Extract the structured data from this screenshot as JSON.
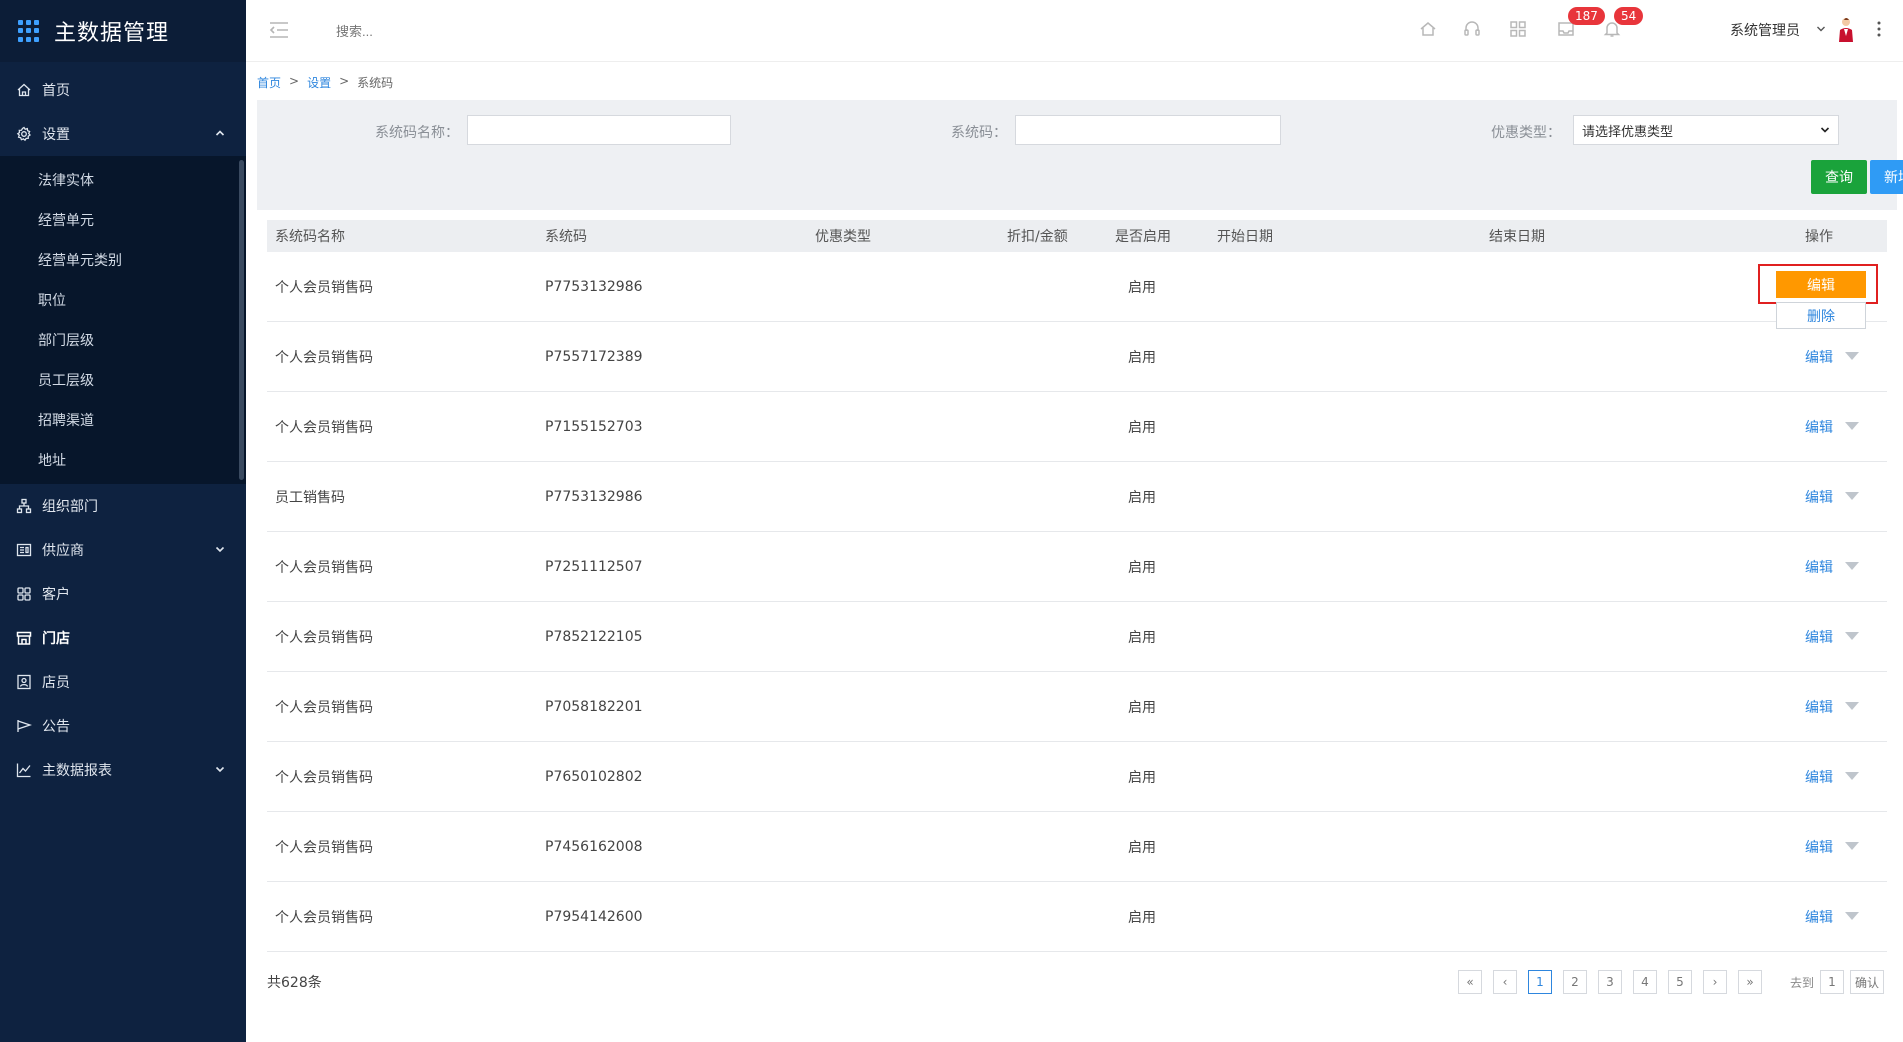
{
  "app": {
    "title": "主数据管理"
  },
  "sidebar": {
    "items": [
      {
        "label": "首页",
        "icon": "home-icon"
      },
      {
        "label": "设置",
        "icon": "gear-icon"
      },
      {
        "label": "组织部门",
        "icon": "org-tree-icon"
      },
      {
        "label": "供应商",
        "icon": "supplier-icon"
      },
      {
        "label": "客户",
        "icon": "customer-icon"
      },
      {
        "label": "门店",
        "icon": "store-icon"
      },
      {
        "label": "店员",
        "icon": "staff-icon"
      },
      {
        "label": "公告",
        "icon": "announcement-icon"
      },
      {
        "label": "主数据报表",
        "icon": "report-chart-icon"
      }
    ],
    "settings_submenu": [
      "法律实体",
      "经营单元",
      "经营单元类别",
      "职位",
      "部门层级",
      "员工层级",
      "招聘渠道",
      "地址"
    ]
  },
  "header": {
    "search_placeholder": "搜索...",
    "messages_badge": "187",
    "notifications_badge": "54",
    "user_name": "系统管理员"
  },
  "breadcrumb": {
    "home": "首页",
    "settings": "设置",
    "current": "系统码",
    "sep": ">"
  },
  "filter": {
    "name_label": "系统码名称：",
    "code_label": "系统码：",
    "type_label": "优惠类型：",
    "type_select_value": "请选择优惠类型",
    "query_button": "查询",
    "add_button": "新增"
  },
  "table": {
    "columns": [
      "系统码名称",
      "系统码",
      "优惠类型",
      "折扣/金额",
      "是否启用",
      "开始日期",
      "结束日期",
      "操作"
    ],
    "rows": [
      {
        "name": "个人会员销售码",
        "code": "P7753132986",
        "type": "",
        "discount": "",
        "enabled": "启用",
        "start": "",
        "end": ""
      },
      {
        "name": "个人会员销售码",
        "code": "P7557172389",
        "type": "",
        "discount": "",
        "enabled": "启用",
        "start": "",
        "end": ""
      },
      {
        "name": "个人会员销售码",
        "code": "P7155152703",
        "type": "",
        "discount": "",
        "enabled": "启用",
        "start": "",
        "end": ""
      },
      {
        "name": "员工销售码",
        "code": "P7753132986",
        "type": "",
        "discount": "",
        "enabled": "启用",
        "start": "",
        "end": ""
      },
      {
        "name": "个人会员销售码",
        "code": "P7251112507",
        "type": "",
        "discount": "",
        "enabled": "启用",
        "start": "",
        "end": ""
      },
      {
        "name": "个人会员销售码",
        "code": "P7852122105",
        "type": "",
        "discount": "",
        "enabled": "启用",
        "start": "",
        "end": ""
      },
      {
        "name": "个人会员销售码",
        "code": "P7058182201",
        "type": "",
        "discount": "",
        "enabled": "启用",
        "start": "",
        "end": ""
      },
      {
        "name": "个人会员销售码",
        "code": "P7650102802",
        "type": "",
        "discount": "",
        "enabled": "启用",
        "start": "",
        "end": ""
      },
      {
        "name": "个人会员销售码",
        "code": "P7456162008",
        "type": "",
        "discount": "",
        "enabled": "启用",
        "start": "",
        "end": ""
      },
      {
        "name": "个人会员销售码",
        "code": "P7954142600",
        "type": "",
        "discount": "",
        "enabled": "启用",
        "start": "",
        "end": ""
      }
    ],
    "edit_label": "编辑",
    "delete_label": "删除"
  },
  "footer": {
    "total": "共628条",
    "first": "«",
    "prev": "‹",
    "pages": [
      "1",
      "2",
      "3",
      "4",
      "5"
    ],
    "current_page": "1",
    "next": "›",
    "last": "»",
    "goto_label": "去到",
    "goto_value": "1",
    "confirm": "确认"
  },
  "colors": {
    "sidebar_bg": "#0e2240",
    "accent_blue": "#2e86de",
    "query_green": "#1aa33b",
    "add_blue": "#2f9bf5",
    "edit_orange": "#ff9800",
    "badge_red": "#e8353b"
  }
}
